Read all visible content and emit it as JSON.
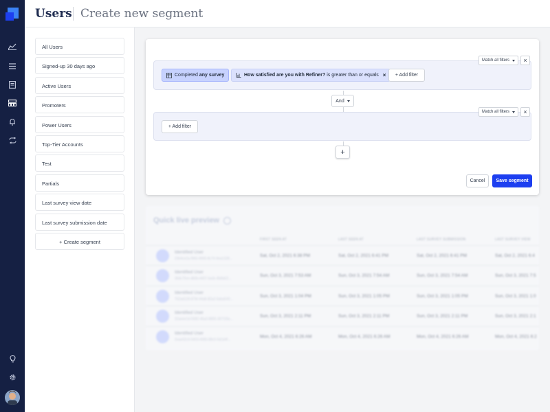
{
  "header": {
    "title": "Users",
    "subtitle": "Create new segment"
  },
  "rail": {
    "icons": [
      "logo-icon",
      "analytics-icon",
      "list-icon",
      "document-icon",
      "segments-icon",
      "bell-icon",
      "integrations-icon",
      "lightbulb-icon",
      "gear-icon"
    ],
    "brand_color": "#1d3ff0",
    "background": "#152043"
  },
  "segments": {
    "items": [
      "All Users",
      "Signed-up 30 days ago",
      "Active Users",
      "Promoters",
      "Power Users",
      "Top-Tier Accounts",
      "Test",
      "Partials",
      "Last survey view date",
      "Last survey submission date"
    ],
    "create_label": "+ Create segment"
  },
  "editor": {
    "group1": {
      "match_label": "Match all filters",
      "filter1": {
        "prefix": "Completed",
        "bold": "any survey"
      },
      "filter2": {
        "bold": "How satisfied are you with Refiner?",
        "rest": "is greater than or equals"
      },
      "add_filter_label": "+ Add filter"
    },
    "join_label": "And",
    "group2": {
      "match_label": "Match all filters",
      "add_filter_label": "+ Add filter"
    },
    "add_group_label": "+",
    "cancel_label": "Cancel",
    "save_label": "Save segment"
  },
  "preview": {
    "title": "Quick live preview",
    "columns": [
      "FIRST SEEN AT",
      "LAST SEEN AT",
      "LAST SURVEY SUBMISSION",
      "LAST SURVEY VIEW"
    ],
    "rows": [
      {
        "name": "Identified User",
        "id": "23b4ce2a-f960-4960-8c74-9ea1328...",
        "first": "Sat, Oct 2, 2021 6:38 PM",
        "last": "Sat, Oct 2, 2021 6:41 PM",
        "sub": "Sat, Oct 2, 2021 6:41 PM",
        "view": "Sat, Oct 2, 2021 6:4"
      },
      {
        "name": "Identified User",
        "id": "36dc70ce-db5b-4407-ba3c-8b8a02...",
        "first": "Sun, Oct 3, 2021 7:53 AM",
        "last": "Sun, Oct 3, 2021 7:54 AM",
        "sub": "Sun, Oct 3, 2021 7:54 AM",
        "view": "Sun, Oct 3, 2021 7:5"
      },
      {
        "name": "Identified User",
        "id": "762ad139-87bf-44a8-82a2-6aba549...",
        "first": "Sun, Oct 3, 2021 1:04 PM",
        "last": "Sun, Oct 3, 2021 1:05 PM",
        "sub": "Sun, Oct 3, 2021 1:05 PM",
        "view": "Sun, Oct 3, 2021 1:0"
      },
      {
        "name": "Identified User",
        "id": "32aeee1d-5582-45a3-8855-3071f3a...",
        "first": "Sun, Oct 3, 2021 2:11 PM",
        "last": "Sun, Oct 3, 2021 2:11 PM",
        "sub": "Sun, Oct 3, 2021 2:11 PM",
        "view": "Sun, Oct 3, 2021 2:1"
      },
      {
        "name": "Identified User",
        "id": "2eae02c9-5403-4083-88c0-5d1d4f...",
        "first": "Mon, Oct 4, 2021 6:26 AM",
        "last": "Mon, Oct 4, 2021 6:26 AM",
        "sub": "Mon, Oct 4, 2021 6:26 AM",
        "view": "Mon, Oct 4, 2021 6:2"
      }
    ]
  }
}
